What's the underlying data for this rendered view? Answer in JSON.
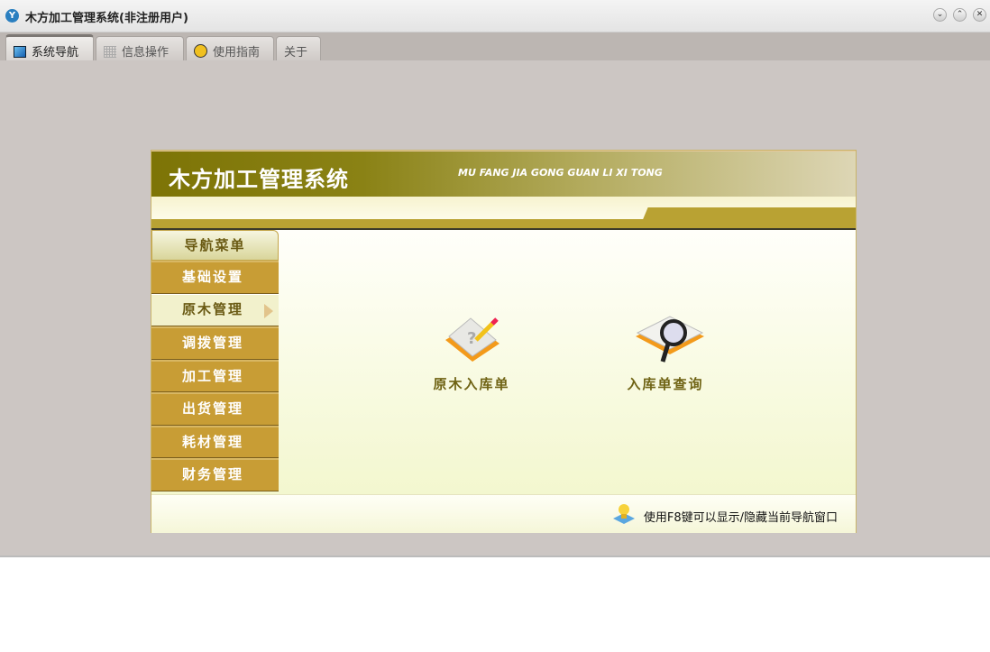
{
  "window": {
    "title": "木方加工管理系统(非注册用户)",
    "controls": [
      "minimize",
      "maximize",
      "close"
    ]
  },
  "tabs": [
    {
      "label": "系统导航",
      "icon": "monitor-icon",
      "active": true
    },
    {
      "label": "信息操作",
      "icon": "grid-icon"
    },
    {
      "label": "使用指南",
      "icon": "help-icon"
    },
    {
      "label": "关于"
    }
  ],
  "header": {
    "title": "木方加工管理系统",
    "subtitle": "MU FANG JIA GONG GUAN LI XI TONG"
  },
  "nav": {
    "heading": "导航菜单",
    "items": [
      {
        "label": "基础设置"
      },
      {
        "label": "原木管理",
        "active": true
      },
      {
        "label": "调拨管理"
      },
      {
        "label": "加工管理"
      },
      {
        "label": "出货管理"
      },
      {
        "label": "耗材管理"
      },
      {
        "label": "财务管理"
      }
    ]
  },
  "functions": [
    {
      "label": "原木入库单",
      "icon": "notebook-pencil-icon"
    },
    {
      "label": "入库单查询",
      "icon": "magnifier-book-icon"
    }
  ],
  "footer": {
    "tip": "使用F8键可以显示/隐藏当前导航窗口"
  }
}
